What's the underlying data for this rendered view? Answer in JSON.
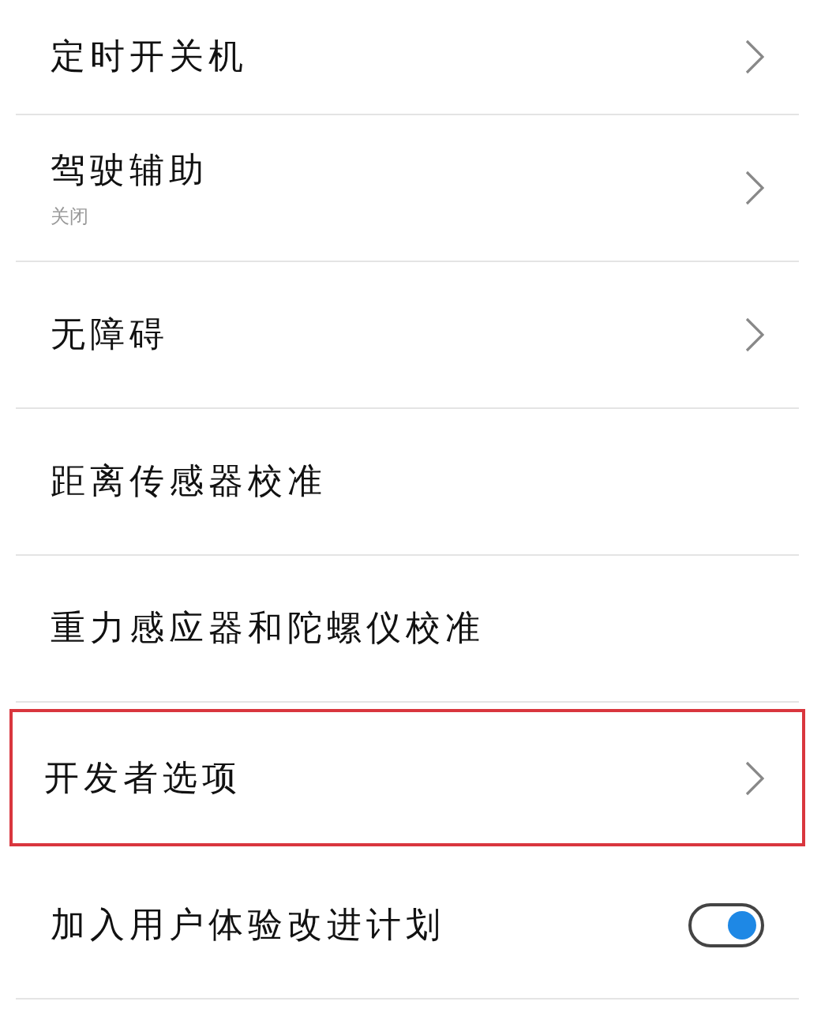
{
  "settings_items": [
    {
      "kind": "link",
      "title": "定时开关机",
      "highlighted": false
    },
    {
      "kind": "link",
      "title": "驾驶辅助",
      "subtitle": "关闭",
      "highlighted": false
    },
    {
      "kind": "link",
      "title": "无障碍",
      "highlighted": false
    },
    {
      "kind": "plain",
      "title": "距离传感器校准",
      "highlighted": false
    },
    {
      "kind": "plain",
      "title": "重力感应器和陀螺仪校准",
      "highlighted": false
    },
    {
      "kind": "link",
      "title": "开发者选项",
      "highlighted": true
    },
    {
      "kind": "toggle",
      "title": "加入用户体验改进计划",
      "on": true,
      "highlighted": false
    }
  ]
}
